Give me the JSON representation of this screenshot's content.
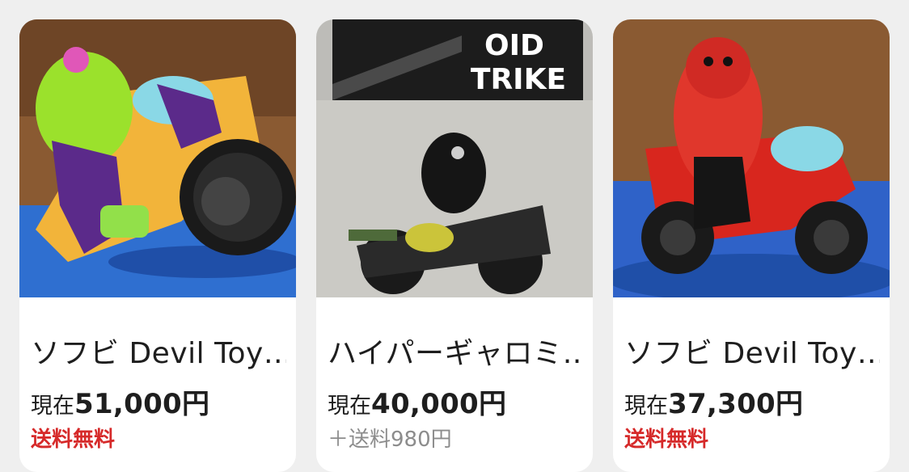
{
  "products": [
    {
      "title": "ソフビ Devil Toy…",
      "price_label": "現在",
      "price_value": "51,000円",
      "shipping": "送料無料",
      "shipping_free": true,
      "image_icon": "toy-figure-image"
    },
    {
      "title": "ハイパーギャロミ…",
      "price_label": "現在",
      "price_value": "40,000円",
      "shipping": "＋送料980円",
      "shipping_free": false,
      "image_icon": "toy-figure-image",
      "package_text": "OID\nTRIKE"
    },
    {
      "title": "ソフビ Devil Toy…",
      "price_label": "現在",
      "price_value": "37,300円",
      "shipping": "送料無料",
      "shipping_free": true,
      "image_icon": "toy-figure-image"
    }
  ],
  "colors": {
    "background": "#efefef",
    "card": "#ffffff",
    "free_shipping": "#d62a2a",
    "paid_shipping": "#8c8c8c"
  }
}
